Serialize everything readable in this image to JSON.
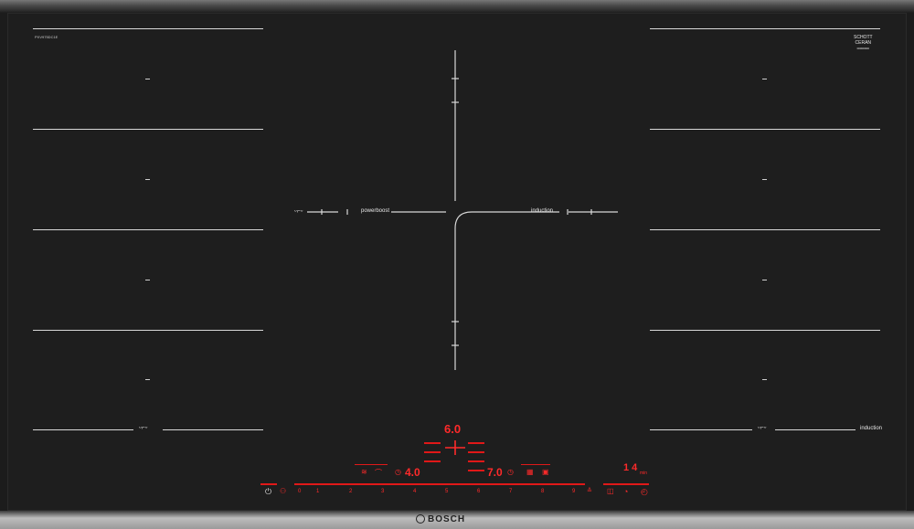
{
  "model": "PXV975DC1E",
  "glass_brand": {
    "line1": "SCHOTT",
    "line2": "CERAN",
    "line3": "00000000"
  },
  "labels": {
    "powerboost_center": "powerboost",
    "induction_center": "induction",
    "induction_right": "induction"
  },
  "displays": {
    "center_top": "6.0",
    "left_value": "4.0",
    "right_value": "7.0",
    "timer": "1 4",
    "timer_unit": "min"
  },
  "power_scale": [
    "0",
    "1",
    "2",
    "3",
    "4",
    "5",
    "6",
    "7",
    "8",
    "9"
  ],
  "brand": "BOSCH",
  "colors": {
    "glass": "#1e1e1e",
    "marking": "#d8d8d8",
    "display_red": "#ff2a2a"
  }
}
